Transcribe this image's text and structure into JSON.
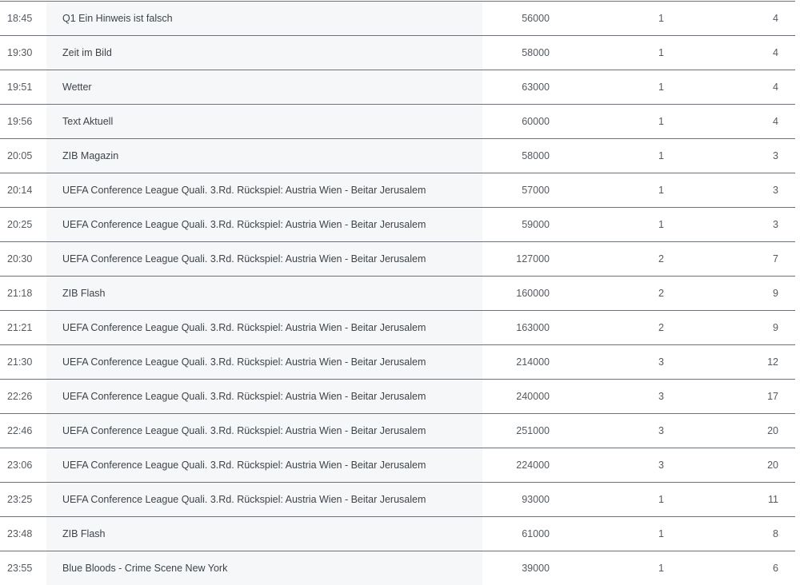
{
  "rows": [
    {
      "time": "18:45",
      "title": "Q1 Ein Hinweis ist falsch",
      "viewers": "56000",
      "rating": "1",
      "share": "4"
    },
    {
      "time": "19:30",
      "title": "Zeit im Bild",
      "viewers": "58000",
      "rating": "1",
      "share": "4"
    },
    {
      "time": "19:51",
      "title": "Wetter",
      "viewers": "63000",
      "rating": "1",
      "share": "4"
    },
    {
      "time": "19:56",
      "title": "Text Aktuell",
      "viewers": "60000",
      "rating": "1",
      "share": "4"
    },
    {
      "time": "20:05",
      "title": "ZIB Magazin",
      "viewers": "58000",
      "rating": "1",
      "share": "3"
    },
    {
      "time": "20:14",
      "title": "UEFA Conference League Quali. 3.Rd. Rückspiel: Austria Wien - Beitar Jerusalem",
      "viewers": "57000",
      "rating": "1",
      "share": "3"
    },
    {
      "time": "20:25",
      "title": "UEFA Conference League Quali. 3.Rd. Rückspiel: Austria Wien - Beitar Jerusalem",
      "viewers": "59000",
      "rating": "1",
      "share": "3"
    },
    {
      "time": "20:30",
      "title": "UEFA Conference League Quali. 3.Rd. Rückspiel: Austria Wien - Beitar Jerusalem",
      "viewers": "127000",
      "rating": "2",
      "share": "7"
    },
    {
      "time": "21:18",
      "title": "ZIB Flash",
      "viewers": "160000",
      "rating": "2",
      "share": "9"
    },
    {
      "time": "21:21",
      "title": "UEFA Conference League Quali. 3.Rd. Rückspiel: Austria Wien - Beitar Jerusalem",
      "viewers": "163000",
      "rating": "2",
      "share": "9"
    },
    {
      "time": "21:30",
      "title": "UEFA Conference League Quali. 3.Rd. Rückspiel: Austria Wien - Beitar Jerusalem",
      "viewers": "214000",
      "rating": "3",
      "share": "12"
    },
    {
      "time": "22:26",
      "title": "UEFA Conference League Quali. 3.Rd. Rückspiel: Austria Wien - Beitar Jerusalem",
      "viewers": "240000",
      "rating": "3",
      "share": "17"
    },
    {
      "time": "22:46",
      "title": "UEFA Conference League Quali. 3.Rd. Rückspiel: Austria Wien - Beitar Jerusalem",
      "viewers": "251000",
      "rating": "3",
      "share": "20"
    },
    {
      "time": "23:06",
      "title": "UEFA Conference League Quali. 3.Rd. Rückspiel: Austria Wien - Beitar Jerusalem",
      "viewers": "224000",
      "rating": "3",
      "share": "20"
    },
    {
      "time": "23:25",
      "title": "UEFA Conference League Quali. 3.Rd. Rückspiel: Austria Wien - Beitar Jerusalem",
      "viewers": "93000",
      "rating": "1",
      "share": "11"
    },
    {
      "time": "23:48",
      "title": "ZIB Flash",
      "viewers": "61000",
      "rating": "1",
      "share": "8"
    },
    {
      "time": "23:55",
      "title": "Blue Bloods - Crime Scene New York",
      "viewers": "39000",
      "rating": "1",
      "share": "6"
    }
  ]
}
